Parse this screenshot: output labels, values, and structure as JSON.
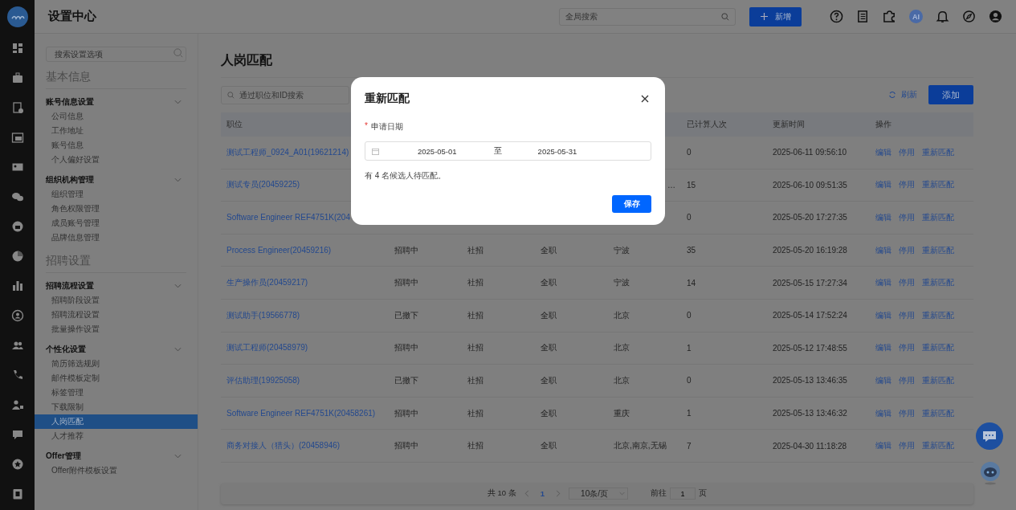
{
  "app": {
    "title": "设置中心"
  },
  "header": {
    "search": {
      "placeholder": "全局搜索"
    },
    "new_button": "新增",
    "ai_badge": "AI"
  },
  "sidebar": {
    "search": {
      "placeholder": "搜索设置选项"
    },
    "sections": [
      {
        "title": "基本信息",
        "groups": [
          {
            "title": "账号信息设置",
            "expanded": true,
            "items": [
              {
                "label": "公司信息",
                "selected": false
              },
              {
                "label": "工作地址",
                "selected": false
              },
              {
                "label": "账号信息",
                "selected": false
              },
              {
                "label": "个人偏好设置",
                "selected": false
              }
            ]
          },
          {
            "title": "组织机构管理",
            "expanded": true,
            "items": [
              {
                "label": "组织管理",
                "selected": false
              },
              {
                "label": "角色权限管理",
                "selected": false
              },
              {
                "label": "成员账号管理",
                "selected": false
              },
              {
                "label": "品牌信息管理",
                "selected": false
              }
            ]
          }
        ]
      },
      {
        "title": "招聘设置",
        "groups": [
          {
            "title": "招聘流程设置",
            "expanded": true,
            "items": [
              {
                "label": "招聘阶段设置",
                "selected": false
              },
              {
                "label": "招聘流程设置",
                "selected": false
              },
              {
                "label": "批量操作设置",
                "selected": false
              }
            ]
          },
          {
            "title": "个性化设置",
            "expanded": true,
            "items": [
              {
                "label": "简历筛选规则",
                "selected": false
              },
              {
                "label": "邮件模板定制",
                "selected": false
              },
              {
                "label": "标签管理",
                "selected": false
              },
              {
                "label": "下载限制",
                "selected": false
              },
              {
                "label": "人岗匹配",
                "selected": true
              },
              {
                "label": "人才推荐",
                "selected": false
              }
            ]
          },
          {
            "title": "Offer管理",
            "expanded": true,
            "items": [
              {
                "label": "Offer附件模板设置",
                "selected": false
              }
            ]
          }
        ]
      }
    ]
  },
  "main": {
    "title": "人岗匹配",
    "search": {
      "placeholder": "通过职位和ID搜索"
    },
    "refresh_button": "刷新",
    "add_button": "添加",
    "table": {
      "columns": [
        {
          "label": "职位"
        },
        {},
        {},
        {},
        {},
        {
          "label": "已计算人次"
        },
        {
          "label": "更新时间"
        },
        {
          "label": "操作"
        }
      ],
      "rows": [
        {
          "position": "测试工程师_0924_A01(19621214)",
          "count": "0",
          "updated": "2025-06-11 09:56:10",
          "actions": [
            "编辑",
            "停用",
            "重新匹配"
          ]
        },
        {
          "position": "测试专员(20459225)",
          "city": "…",
          "count": "15",
          "updated": "2025-06-10 09:51:35",
          "actions": [
            "编辑",
            "停用",
            "重新匹配"
          ]
        },
        {
          "position": "Software Engineer REF4751K(204",
          "count": "0",
          "updated": "2025-05-20 17:27:35",
          "actions": [
            "编辑",
            "停用",
            "重新匹配"
          ]
        },
        {
          "position": "Process Engineer(20459216)",
          "status": "招聘中",
          "type": "社招",
          "nature": "全职",
          "city": "宁波",
          "count": "35",
          "updated": "2025-05-20 16:19:28",
          "actions": [
            "编辑",
            "停用",
            "重新匹配"
          ]
        },
        {
          "position": "生产操作员(20459217)",
          "status": "招聘中",
          "type": "社招",
          "nature": "全职",
          "city": "宁波",
          "count": "14",
          "updated": "2025-05-15 17:27:34",
          "actions": [
            "编辑",
            "停用",
            "重新匹配"
          ]
        },
        {
          "position": "测试助手(19566778)",
          "status": "已撤下",
          "type": "社招",
          "nature": "全职",
          "city": "北京",
          "count": "0",
          "updated": "2025-05-14 17:52:24",
          "actions": [
            "编辑",
            "停用",
            "重新匹配"
          ]
        },
        {
          "position": "测试工程师(20458979)",
          "status": "招聘中",
          "type": "社招",
          "nature": "全职",
          "city": "北京",
          "count": "1",
          "updated": "2025-05-12 17:48:55",
          "actions": [
            "编辑",
            "停用",
            "重新匹配"
          ]
        },
        {
          "position": "评估助理(19925058)",
          "status": "已撤下",
          "type": "社招",
          "nature": "全职",
          "city": "北京",
          "count": "0",
          "updated": "2025-05-13 13:46:35",
          "actions": [
            "编辑",
            "停用",
            "重新匹配"
          ]
        },
        {
          "position": "Software Engineer REF4751K(20458261)",
          "status": "招聘中",
          "type": "社招",
          "nature": "全职",
          "city": "重庆",
          "count": "1",
          "updated": "2025-05-13 13:46:32",
          "actions": [
            "编辑",
            "停用",
            "重新匹配"
          ]
        },
        {
          "position": "商务对接人（猎头）(20458946)",
          "status": "招聘中",
          "type": "社招",
          "nature": "全职",
          "city": "北京,南京,无锡",
          "count": "7",
          "updated": "2025-04-30 11:18:28",
          "actions": [
            "编辑",
            "停用",
            "重新匹配"
          ]
        }
      ]
    },
    "pagination": {
      "total": "共 10 条",
      "pages": [
        {
          "label": "1",
          "selected": true
        }
      ],
      "page_size": "10条/页",
      "goto_label": "前往",
      "goto_value": "1",
      "goto_suffix": "页"
    }
  },
  "modal": {
    "title": "重新匹配",
    "field_label": "申请日期",
    "required_mark": "*",
    "start_date": "2025-05-01",
    "separator": "至",
    "end_date": "2025-05-31",
    "note": "有 4 名候选人待匹配。",
    "save_button": "保存"
  }
}
